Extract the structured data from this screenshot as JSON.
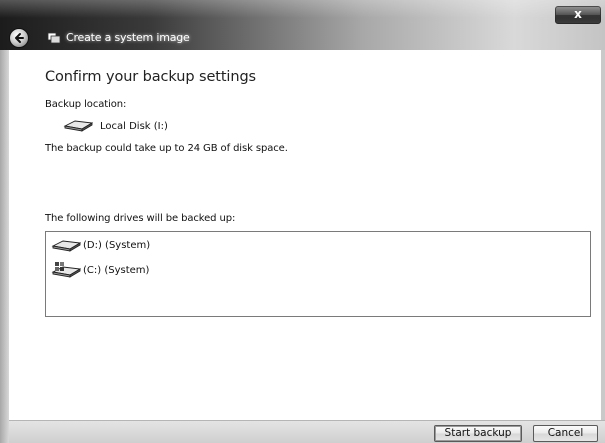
{
  "window": {
    "title": "Create a system image",
    "close_label": "x"
  },
  "main": {
    "heading": "Confirm your backup settings",
    "backup_location_label": "Backup location:",
    "backup_location": {
      "name": "Local Disk (I:)",
      "icon": "hard-drive-icon"
    },
    "space_note": "The backup could take up to 24 GB of disk space.",
    "drives_label": "The following drives will be backed up:",
    "drives": [
      {
        "label": "(D:) (System)",
        "icon": "hard-drive-icon"
      },
      {
        "label": "(C:) (System)",
        "icon": "windows-drive-icon"
      }
    ]
  },
  "buttons": {
    "start_backup": "Start backup",
    "cancel": "Cancel"
  }
}
